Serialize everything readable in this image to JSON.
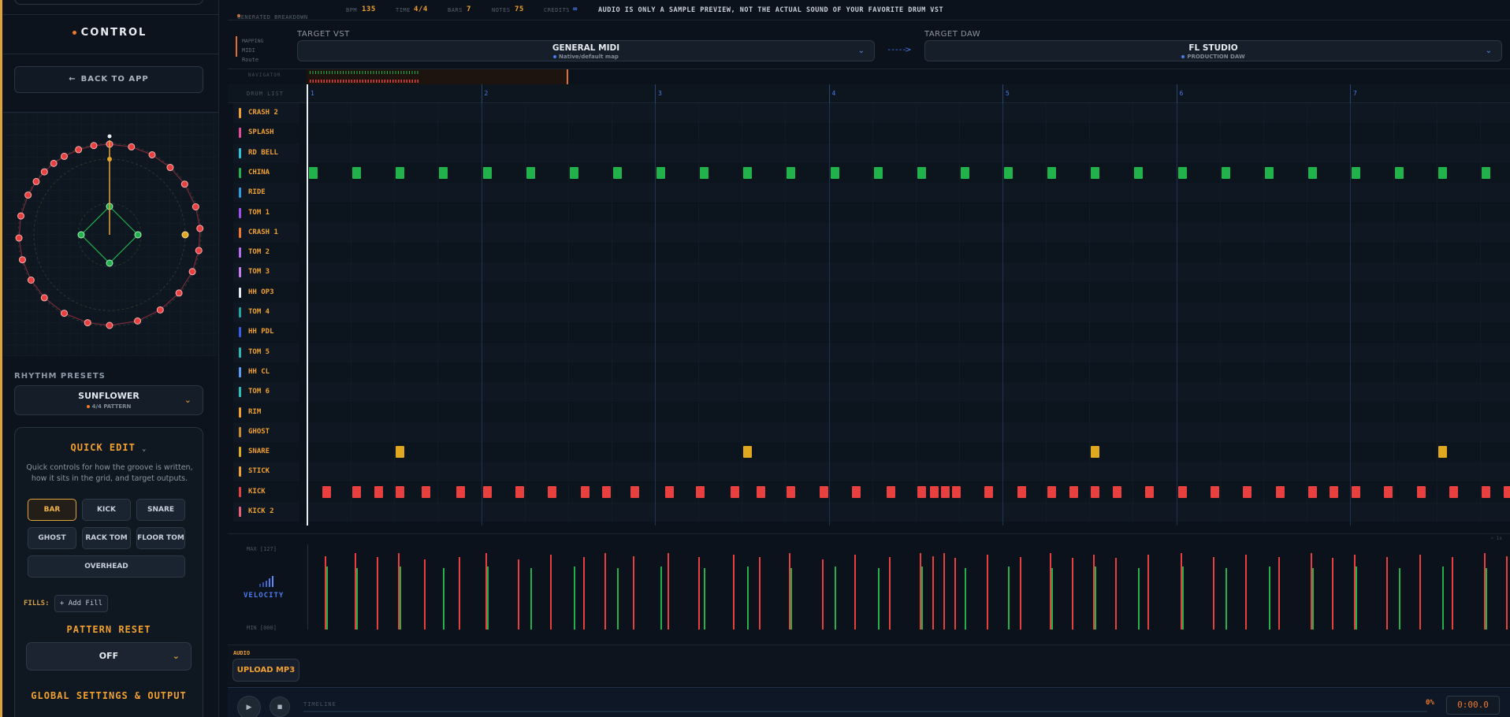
{
  "sidebar": {
    "title": "CONTROL",
    "back_label": "BACK TO APP",
    "presets_label": "RHYTHM PRESETS",
    "preset": {
      "name": "SUNFLOWER",
      "sub": "4/4 PATTERN"
    },
    "quick_edit": {
      "title": "QUICK EDIT",
      "description": "Quick controls for how the groove is written, how it sits in the grid, and target outputs.",
      "chips": [
        "BAR",
        "KICK",
        "SNARE",
        "GHOST",
        "RACK TOM",
        "FLOOR TOM",
        "OVERHEAD"
      ],
      "active_chip": "BAR"
    },
    "fills_label": "FILLS:",
    "add_fill_label": "+ Add Fill",
    "pattern_reset": {
      "title": "PATTERN RESET",
      "value": "OFF"
    },
    "global_title": "GLOBAL SETTINGS & OUTPUT"
  },
  "infobar": {
    "mode": "GENERATED BREAKDOWN",
    "bpm_label": "BPM",
    "bpm": "135",
    "time_label": "TIME",
    "time": "4/4",
    "bars_label": "BARS",
    "bars": "7",
    "notes_label": "NOTES",
    "notes": "75",
    "credits_label": "CREDITS",
    "credits": "∞",
    "notice": "AUDIO IS ONLY A SAMPLE PREVIEW, NOT THE ACTUAL SOUND OF YOUR FAVORITE DRUM VST"
  },
  "mapping": {
    "title": "MAPPING",
    "sub": "MIDI Route",
    "vst_label": "TARGET VST",
    "vst_name": "GENERAL MIDI",
    "vst_sub": "Native/default map",
    "daw_label": "TARGET DAW",
    "daw_name": "FL STUDIO",
    "daw_sub": "PRODUCTION DAW"
  },
  "navigator_label": "NAVIGATOR",
  "drum_list_label": "DRUM LIST",
  "bars": [
    "1",
    "2",
    "3",
    "4",
    "5",
    "6",
    "7"
  ],
  "colors": {
    "accent": "#f0a030",
    "china_note": "#22b24c",
    "snare_note": "#e0a81e",
    "kick_note": "#e8403f",
    "blue": "#4a7cf0"
  },
  "rows": [
    {
      "name": "CRASH 2",
      "color": "#f0a030",
      "notes": []
    },
    {
      "name": "SPLASH",
      "color": "#e84a9a",
      "notes": []
    },
    {
      "name": "RD BELL",
      "color": "#2ec4d6",
      "notes": []
    },
    {
      "name": "CHINA",
      "color": "#22b24c",
      "notes": [
        0,
        1,
        2,
        3,
        4,
        5,
        6,
        7,
        8,
        9,
        10,
        11,
        12,
        13,
        14,
        15,
        16,
        17,
        18,
        19,
        20,
        21,
        22,
        23,
        24,
        25,
        26,
        27
      ]
    },
    {
      "name": "RIDE",
      "color": "#2a9ee0",
      "notes": []
    },
    {
      "name": "TOM 1",
      "color": "#a24ef0",
      "notes": []
    },
    {
      "name": "CRASH 1",
      "color": "#f07a2a",
      "notes": []
    },
    {
      "name": "TOM 2",
      "color": "#b86ef0",
      "notes": []
    },
    {
      "name": "TOM 3",
      "color": "#c77ef0",
      "notes": []
    },
    {
      "name": "HH OP3",
      "color": "#e8edf2",
      "notes": []
    },
    {
      "name": "TOM 4",
      "color": "#22a7a0",
      "notes": []
    },
    {
      "name": "HH PDL",
      "color": "#3a5ee8",
      "notes": []
    },
    {
      "name": "TOM 5",
      "color": "#2bb8b0",
      "notes": []
    },
    {
      "name": "HH CL",
      "color": "#5b9cf5",
      "notes": []
    },
    {
      "name": "TOM 6",
      "color": "#2ac2b8",
      "notes": []
    },
    {
      "name": "RIM",
      "color": "#f0a030",
      "notes": []
    },
    {
      "name": "GHOST",
      "color": "#c88a2a",
      "notes": []
    },
    {
      "name": "SNARE",
      "color": "#e0a81e",
      "notes": [
        2,
        10,
        18,
        26
      ]
    },
    {
      "name": "STICK",
      "color": "#f0a030",
      "notes": []
    },
    {
      "name": "KICK",
      "color": "#e8403f",
      "notes": [
        0.3,
        1,
        1.5,
        2,
        2.6,
        3.4,
        4,
        4.75,
        5.5,
        6.25,
        6.75,
        7.4,
        8.2,
        8.9,
        9.7,
        10.3,
        11,
        11.75,
        12.5,
        13.3,
        14,
        14.3,
        14.55,
        14.8,
        15.55,
        16.3,
        17,
        17.5,
        18,
        18.5,
        19.25,
        20,
        20.75,
        21.5,
        22.25,
        23,
        23.5,
        24,
        24.75,
        25.5,
        26.25,
        27,
        27.5
      ]
    },
    {
      "name": "KICK 2",
      "color": "#e8607a",
      "notes": []
    }
  ],
  "velocity": {
    "max_label": "MAX [127]",
    "min_label": "MIN [000]",
    "label": "VELOCITY",
    "zoom_label": "⌕ 1x",
    "bars": [
      {
        "x": 0.3,
        "v": 0.86,
        "c": "kick"
      },
      {
        "x": 0.3,
        "v": 0.74,
        "c": "china"
      },
      {
        "x": 1,
        "v": 0.9,
        "c": "kick"
      },
      {
        "x": 1,
        "v": 0.72,
        "c": "china"
      },
      {
        "x": 1.5,
        "v": 0.85,
        "c": "kick"
      },
      {
        "x": 2,
        "v": 0.9,
        "c": "kick"
      },
      {
        "x": 2,
        "v": 0.74,
        "c": "china"
      },
      {
        "x": 2.6,
        "v": 0.82,
        "c": "kick"
      },
      {
        "x": 3,
        "v": 0.72,
        "c": "china"
      },
      {
        "x": 3.4,
        "v": 0.85,
        "c": "kick"
      },
      {
        "x": 4,
        "v": 0.9,
        "c": "kick"
      },
      {
        "x": 4,
        "v": 0.74,
        "c": "china"
      },
      {
        "x": 4.75,
        "v": 0.82,
        "c": "kick"
      },
      {
        "x": 5,
        "v": 0.72,
        "c": "china"
      },
      {
        "x": 5.5,
        "v": 0.88,
        "c": "kick"
      },
      {
        "x": 6,
        "v": 0.74,
        "c": "china"
      },
      {
        "x": 6.25,
        "v": 0.85,
        "c": "kick"
      },
      {
        "x": 6.75,
        "v": 0.9,
        "c": "kick"
      },
      {
        "x": 7,
        "v": 0.72,
        "c": "china"
      },
      {
        "x": 7.4,
        "v": 0.86,
        "c": "kick"
      },
      {
        "x": 8,
        "v": 0.74,
        "c": "china"
      },
      {
        "x": 8.2,
        "v": 0.9,
        "c": "kick"
      },
      {
        "x": 8.9,
        "v": 0.85,
        "c": "kick"
      },
      {
        "x": 9,
        "v": 0.72,
        "c": "china"
      },
      {
        "x": 9.7,
        "v": 0.88,
        "c": "kick"
      },
      {
        "x": 10,
        "v": 0.74,
        "c": "china"
      },
      {
        "x": 10.3,
        "v": 0.85,
        "c": "kick"
      },
      {
        "x": 11,
        "v": 0.9,
        "c": "kick"
      },
      {
        "x": 11,
        "v": 0.72,
        "c": "china"
      },
      {
        "x": 11.75,
        "v": 0.82,
        "c": "kick"
      },
      {
        "x": 12,
        "v": 0.74,
        "c": "china"
      },
      {
        "x": 12.5,
        "v": 0.88,
        "c": "kick"
      },
      {
        "x": 13,
        "v": 0.72,
        "c": "china"
      },
      {
        "x": 13.3,
        "v": 0.85,
        "c": "kick"
      },
      {
        "x": 14,
        "v": 0.9,
        "c": "kick"
      },
      {
        "x": 14,
        "v": 0.74,
        "c": "china"
      },
      {
        "x": 14.3,
        "v": 0.86,
        "c": "kick"
      },
      {
        "x": 14.55,
        "v": 0.9,
        "c": "kick"
      },
      {
        "x": 14.8,
        "v": 0.84,
        "c": "kick"
      },
      {
        "x": 15,
        "v": 0.72,
        "c": "china"
      },
      {
        "x": 15.55,
        "v": 0.88,
        "c": "kick"
      },
      {
        "x": 16,
        "v": 0.74,
        "c": "china"
      },
      {
        "x": 16.3,
        "v": 0.85,
        "c": "kick"
      },
      {
        "x": 17,
        "v": 0.9,
        "c": "kick"
      },
      {
        "x": 17,
        "v": 0.72,
        "c": "china"
      },
      {
        "x": 17.5,
        "v": 0.84,
        "c": "kick"
      },
      {
        "x": 18,
        "v": 0.88,
        "c": "kick"
      },
      {
        "x": 18,
        "v": 0.74,
        "c": "china"
      },
      {
        "x": 18.5,
        "v": 0.84,
        "c": "kick"
      },
      {
        "x": 19,
        "v": 0.72,
        "c": "china"
      },
      {
        "x": 19.25,
        "v": 0.88,
        "c": "kick"
      },
      {
        "x": 20,
        "v": 0.9,
        "c": "kick"
      },
      {
        "x": 20,
        "v": 0.74,
        "c": "china"
      },
      {
        "x": 20.75,
        "v": 0.85,
        "c": "kick"
      },
      {
        "x": 21,
        "v": 0.72,
        "c": "china"
      },
      {
        "x": 21.5,
        "v": 0.88,
        "c": "kick"
      },
      {
        "x": 22,
        "v": 0.74,
        "c": "china"
      },
      {
        "x": 22.25,
        "v": 0.85,
        "c": "kick"
      },
      {
        "x": 23,
        "v": 0.9,
        "c": "kick"
      },
      {
        "x": 23,
        "v": 0.72,
        "c": "china"
      },
      {
        "x": 23.5,
        "v": 0.84,
        "c": "kick"
      },
      {
        "x": 24,
        "v": 0.88,
        "c": "kick"
      },
      {
        "x": 24,
        "v": 0.74,
        "c": "china"
      },
      {
        "x": 24.75,
        "v": 0.85,
        "c": "kick"
      },
      {
        "x": 25,
        "v": 0.72,
        "c": "china"
      },
      {
        "x": 25.5,
        "v": 0.88,
        "c": "kick"
      },
      {
        "x": 26,
        "v": 0.74,
        "c": "china"
      },
      {
        "x": 26.25,
        "v": 0.85,
        "c": "kick"
      },
      {
        "x": 27,
        "v": 0.9,
        "c": "kick"
      },
      {
        "x": 27,
        "v": 0.72,
        "c": "china"
      },
      {
        "x": 27.5,
        "v": 0.86,
        "c": "kick"
      }
    ]
  },
  "audio": {
    "label": "AUDIO",
    "upload_label": "UPLOAD MP3"
  },
  "transport": {
    "play_icon": "▶",
    "stop_icon": "■",
    "timeline_label": "TIMELINE",
    "progress": "0%",
    "time": "0:00.0"
  }
}
